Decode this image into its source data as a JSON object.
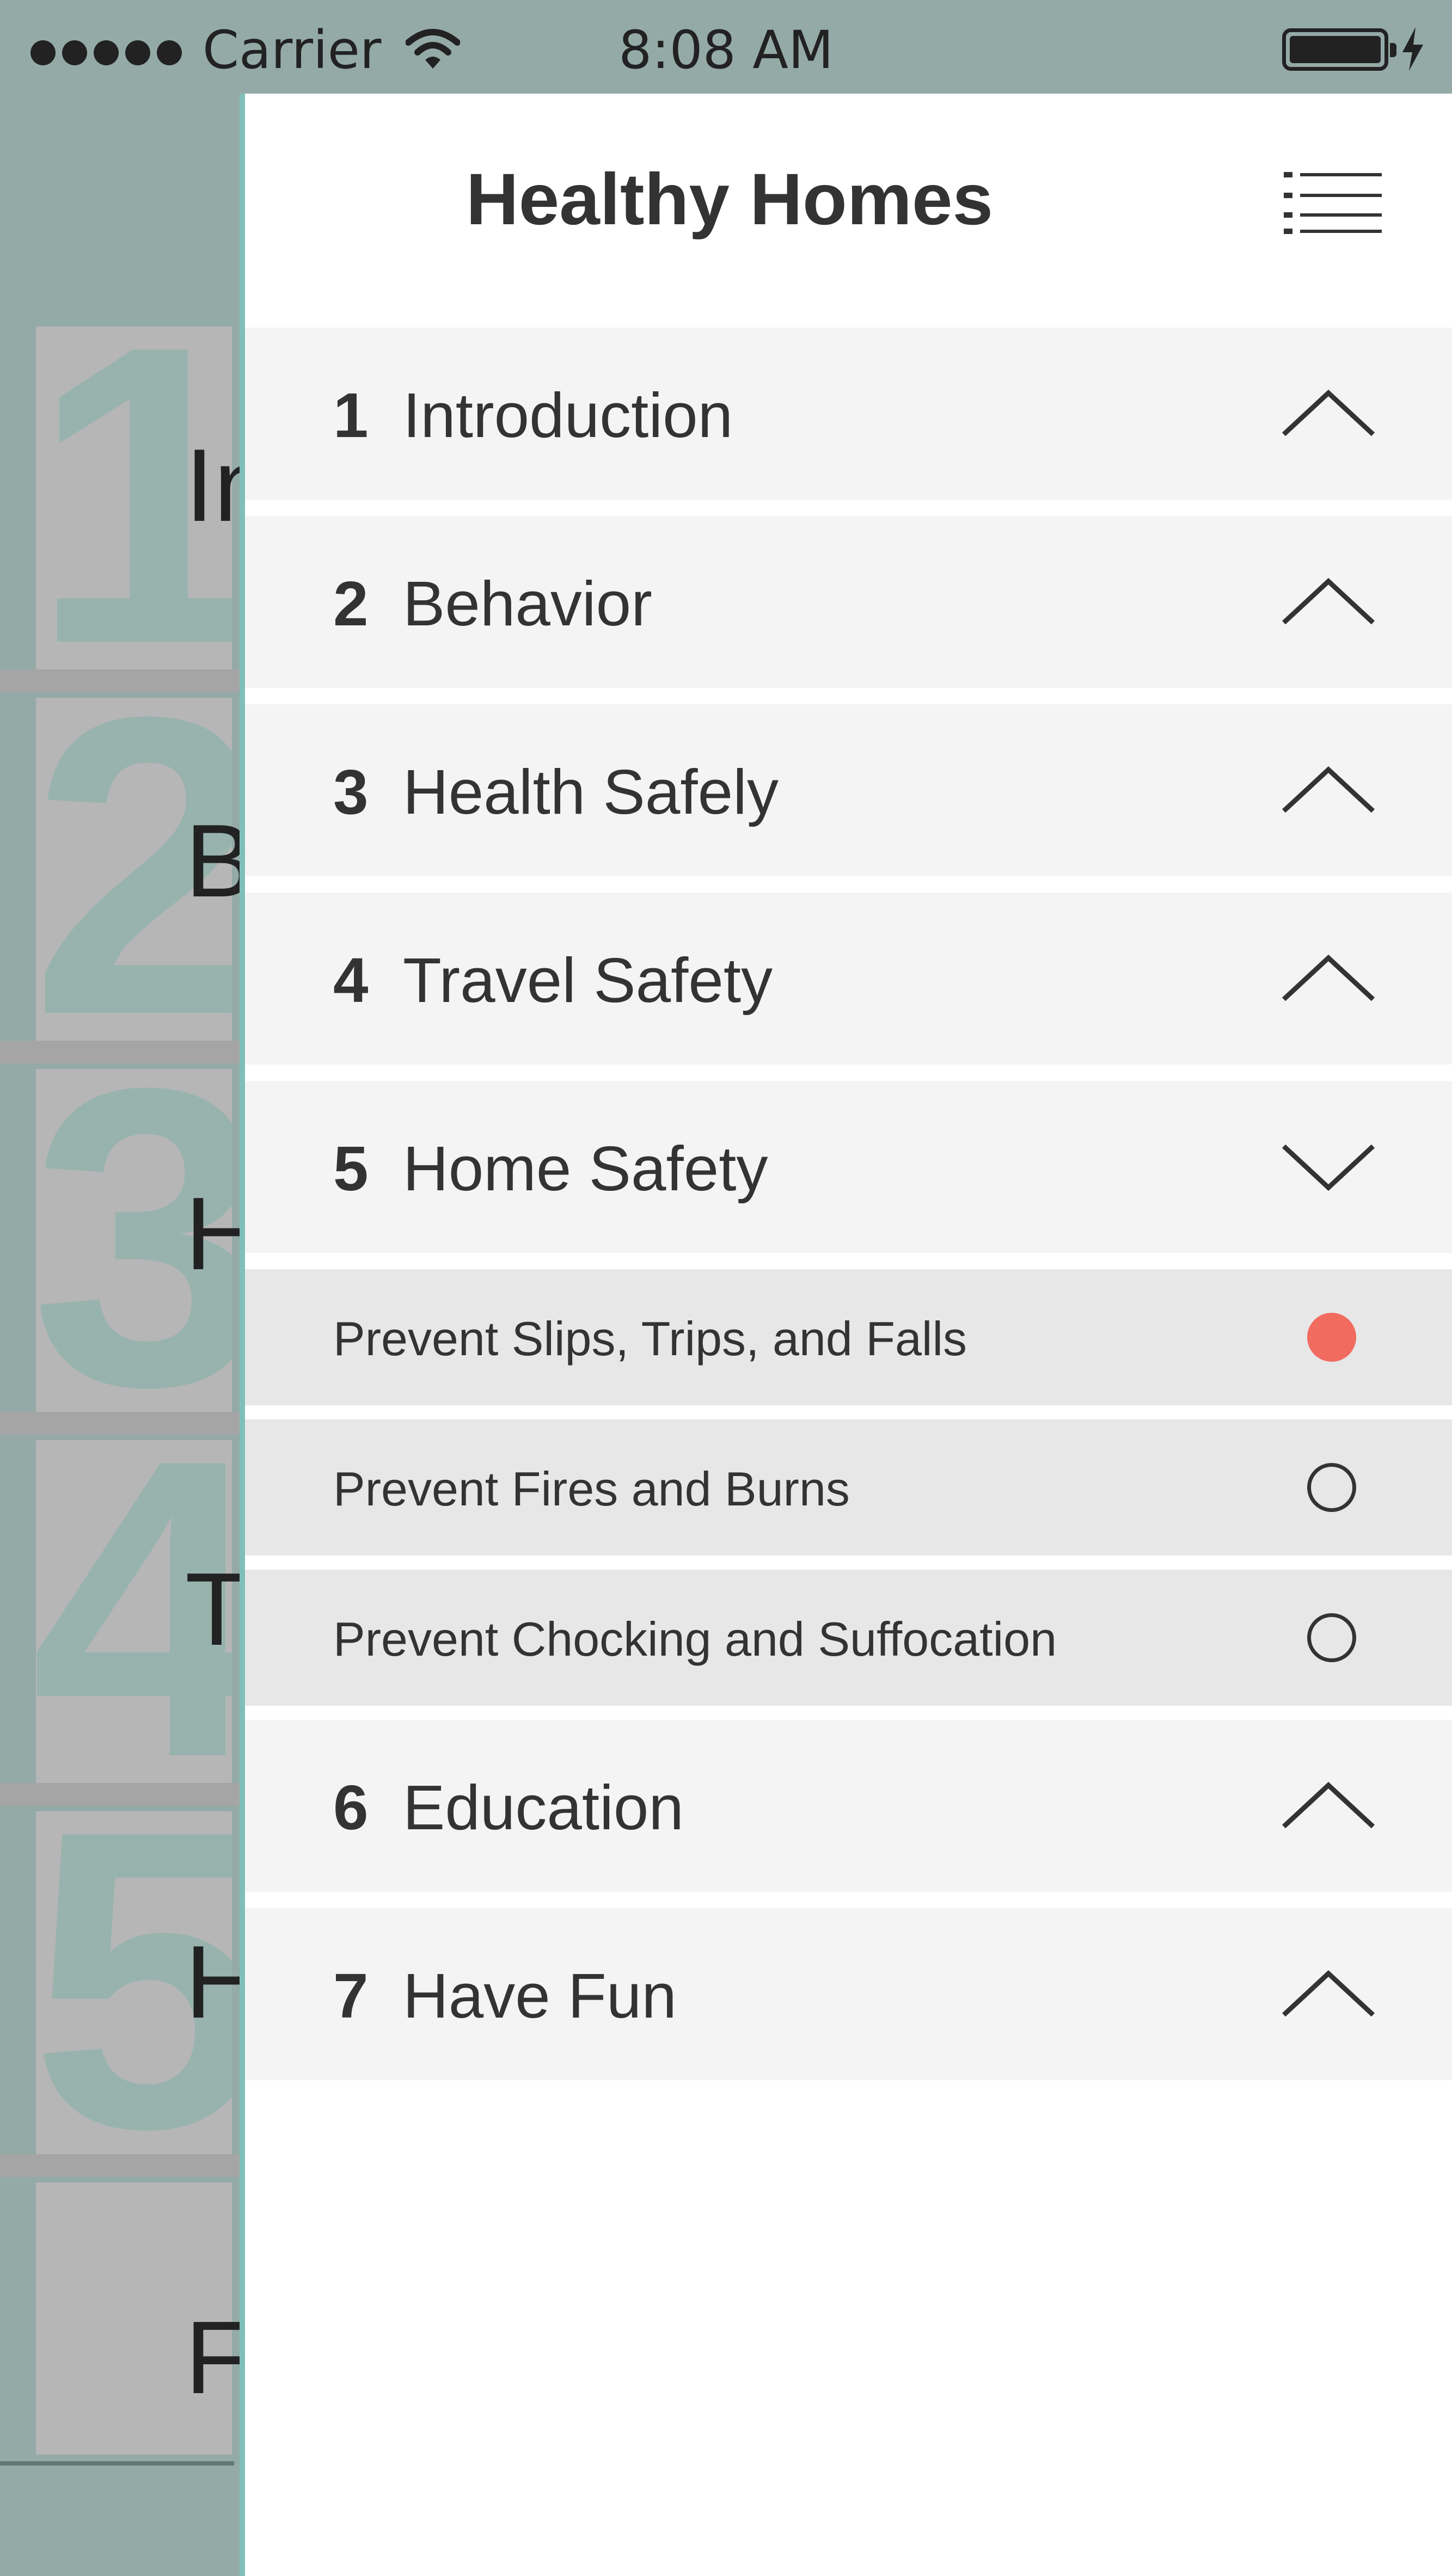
{
  "status_bar": {
    "carrier": "Carrier",
    "time": "8:08 AM",
    "icons": [
      "signal-dots-icon",
      "wifi-icon",
      "battery-icon",
      "charging-bolt-icon"
    ]
  },
  "underlay": {
    "numbers": [
      "1",
      "2",
      "3",
      "4",
      "5"
    ],
    "letters": [
      "In",
      "B",
      "H",
      "T",
      "H",
      "F"
    ]
  },
  "drawer": {
    "title": "Healthy Homes",
    "menu_icon": "list-menu-icon",
    "sections": [
      {
        "num": "1",
        "label": "Introduction",
        "expanded": false
      },
      {
        "num": "2",
        "label": "Behavior",
        "expanded": false
      },
      {
        "num": "3",
        "label": "Health Safely",
        "expanded": false
      },
      {
        "num": "4",
        "label": "Travel Safety",
        "expanded": false
      },
      {
        "num": "5",
        "label": "Home Safety",
        "expanded": true,
        "items": [
          {
            "label": "Prevent Slips, Trips, and Falls",
            "selected": true
          },
          {
            "label": "Prevent Fires and Burns",
            "selected": false
          },
          {
            "label": "Prevent Chocking and Suffocation",
            "selected": false
          }
        ]
      },
      {
        "num": "6",
        "label": "Education",
        "expanded": false
      },
      {
        "num": "7",
        "label": "Have Fun",
        "expanded": false
      }
    ]
  },
  "colors": {
    "status_bg": "#94aaa6",
    "section_bg": "#f4f4f4",
    "subitem_bg": "#e7e7e7",
    "selected_dot": "#f26b5f",
    "text": "#333333"
  }
}
